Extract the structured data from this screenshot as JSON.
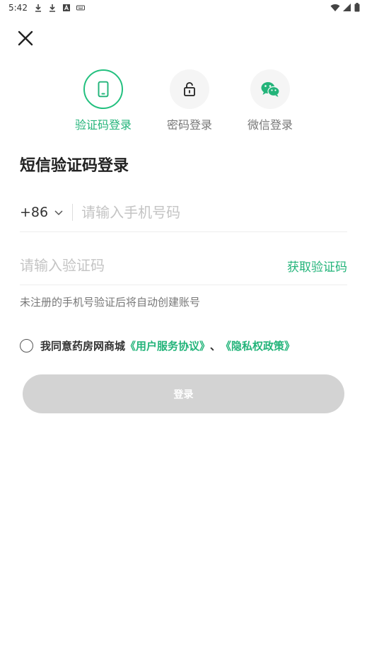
{
  "status_bar": {
    "time": "5:42",
    "left_icons": [
      "download-icon",
      "download-icon",
      "font-icon",
      "keyboard-icon"
    ],
    "right_icons": [
      "wifi-icon",
      "signal-icon",
      "battery-icon"
    ]
  },
  "header": {
    "close_icon": "close-icon"
  },
  "login_tabs": [
    {
      "label": "验证码登录",
      "icon": "phone-icon",
      "active": true
    },
    {
      "label": "密码登录",
      "icon": "lock-icon",
      "active": false
    },
    {
      "label": "微信登录",
      "icon": "wechat-icon",
      "active": false
    }
  ],
  "form": {
    "title": "短信验证码登录",
    "country_code": "+86",
    "phone_placeholder": "请输入手机号码",
    "code_placeholder": "请输入验证码",
    "get_code_label": "获取验证码",
    "hint": "未注册的手机号验证后将自动创建账号"
  },
  "agreement": {
    "prefix": "我同意药房网商城",
    "user_agreement": "《用户服务协议》",
    "separator": "、",
    "privacy_policy": "《隐私权政策》"
  },
  "submit_label": "登录",
  "colors": {
    "accent": "#23b47a",
    "button_disabled": "#d3d3d3",
    "placeholder": "#c4c4c4"
  }
}
